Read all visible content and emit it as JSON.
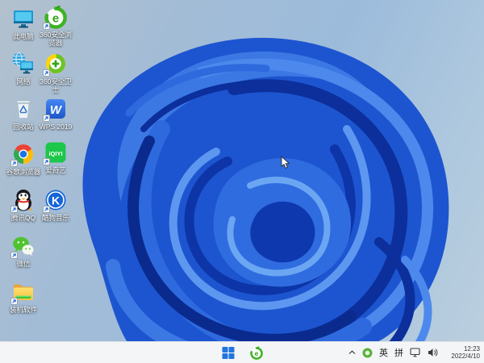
{
  "desktop": {
    "icons": [
      {
        "name": "this-pc",
        "label": "此电脑",
        "shortcut": false
      },
      {
        "name": "360-secure-browser",
        "label": "360安全浏览器",
        "shortcut": true
      },
      {
        "name": "network",
        "label": "网络",
        "shortcut": false
      },
      {
        "name": "360-antivirus",
        "label": "360安全卫士",
        "shortcut": true
      },
      {
        "name": "recycle-bin",
        "label": "回收站",
        "shortcut": false
      },
      {
        "name": "wps-2019",
        "label": "WPS 2019",
        "shortcut": true
      },
      {
        "name": "chrome",
        "label": "谷歌浏览器",
        "shortcut": true
      },
      {
        "name": "iqiyi",
        "label": "爱奇艺",
        "shortcut": true
      },
      {
        "name": "tencent-qq",
        "label": "腾讯QQ",
        "shortcut": true
      },
      {
        "name": "kugou-music",
        "label": "酷狗音乐",
        "shortcut": true
      },
      {
        "name": "wechat",
        "label": "微信",
        "shortcut": true
      },
      {
        "name": "software-folder",
        "label": "装机软件",
        "shortcut": true
      }
    ]
  },
  "taskbar": {
    "tray": {
      "ime_primary": "英",
      "ime_secondary": "拼"
    },
    "clock": {
      "time": "12:23",
      "date": "2022/4/10"
    }
  },
  "colors": {
    "taskbar_bg": "#f4f5f7",
    "desktop_sky": "#9cbbdb",
    "bloom_base": "#1d55d0",
    "bloom_dark": "#0c2f9c",
    "bloom_light": "#5d97f0",
    "start_blue": "#2176de",
    "browser_green": "#3db324"
  }
}
